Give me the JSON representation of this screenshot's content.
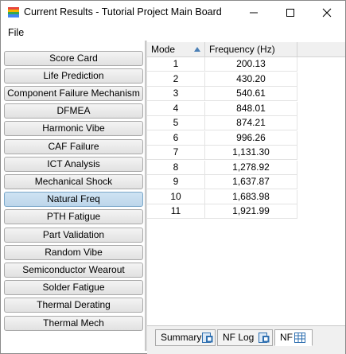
{
  "window": {
    "title": "Current Results - Tutorial Project Main Board",
    "controls": [
      "minimize-icon",
      "maximize-icon",
      "close-icon"
    ]
  },
  "menu": {
    "file": "File"
  },
  "sidebar": {
    "items": [
      {
        "label": "Score Card",
        "active": false
      },
      {
        "label": "Life Prediction",
        "active": false
      },
      {
        "label": "Component Failure Mechanism",
        "active": false
      },
      {
        "label": "DFMEA",
        "active": false
      },
      {
        "label": "Harmonic Vibe",
        "active": false
      },
      {
        "label": "CAF Failure",
        "active": false
      },
      {
        "label": "ICT Analysis",
        "active": false
      },
      {
        "label": "Mechanical Shock",
        "active": false
      },
      {
        "label": "Natural Freq",
        "active": true
      },
      {
        "label": "PTH Fatigue",
        "active": false
      },
      {
        "label": "Part Validation",
        "active": false
      },
      {
        "label": "Random Vibe",
        "active": false
      },
      {
        "label": "Semiconductor Wearout",
        "active": false
      },
      {
        "label": "Solder Fatigue",
        "active": false
      },
      {
        "label": "Thermal Derating",
        "active": false
      },
      {
        "label": "Thermal Mech",
        "active": false
      }
    ]
  },
  "grid": {
    "columns": [
      "Mode",
      "Frequency (Hz)"
    ],
    "sort_column": "Mode",
    "sort_direction": "ascending",
    "rows": [
      {
        "mode": "1",
        "frequency": "200.13"
      },
      {
        "mode": "2",
        "frequency": "430.20"
      },
      {
        "mode": "3",
        "frequency": "540.61"
      },
      {
        "mode": "4",
        "frequency": "848.01"
      },
      {
        "mode": "5",
        "frequency": "874.21"
      },
      {
        "mode": "6",
        "frequency": "996.26"
      },
      {
        "mode": "7",
        "frequency": "1,131.30"
      },
      {
        "mode": "8",
        "frequency": "1,278.92"
      },
      {
        "mode": "9",
        "frequency": "1,637.87"
      },
      {
        "mode": "10",
        "frequency": "1,683.98"
      },
      {
        "mode": "11",
        "frequency": "1,921.99"
      }
    ]
  },
  "tabs": [
    {
      "label": "Summary",
      "icon": "report-icon",
      "active": false
    },
    {
      "label": "NF Log",
      "icon": "report-icon",
      "active": false
    },
    {
      "label": "NF",
      "icon": "table-icon",
      "active": true
    }
  ],
  "colors": {
    "active_nav": "#c4dbee",
    "sort_arrow": "#4a7fb5",
    "header_bg": "#f0f0f0"
  }
}
